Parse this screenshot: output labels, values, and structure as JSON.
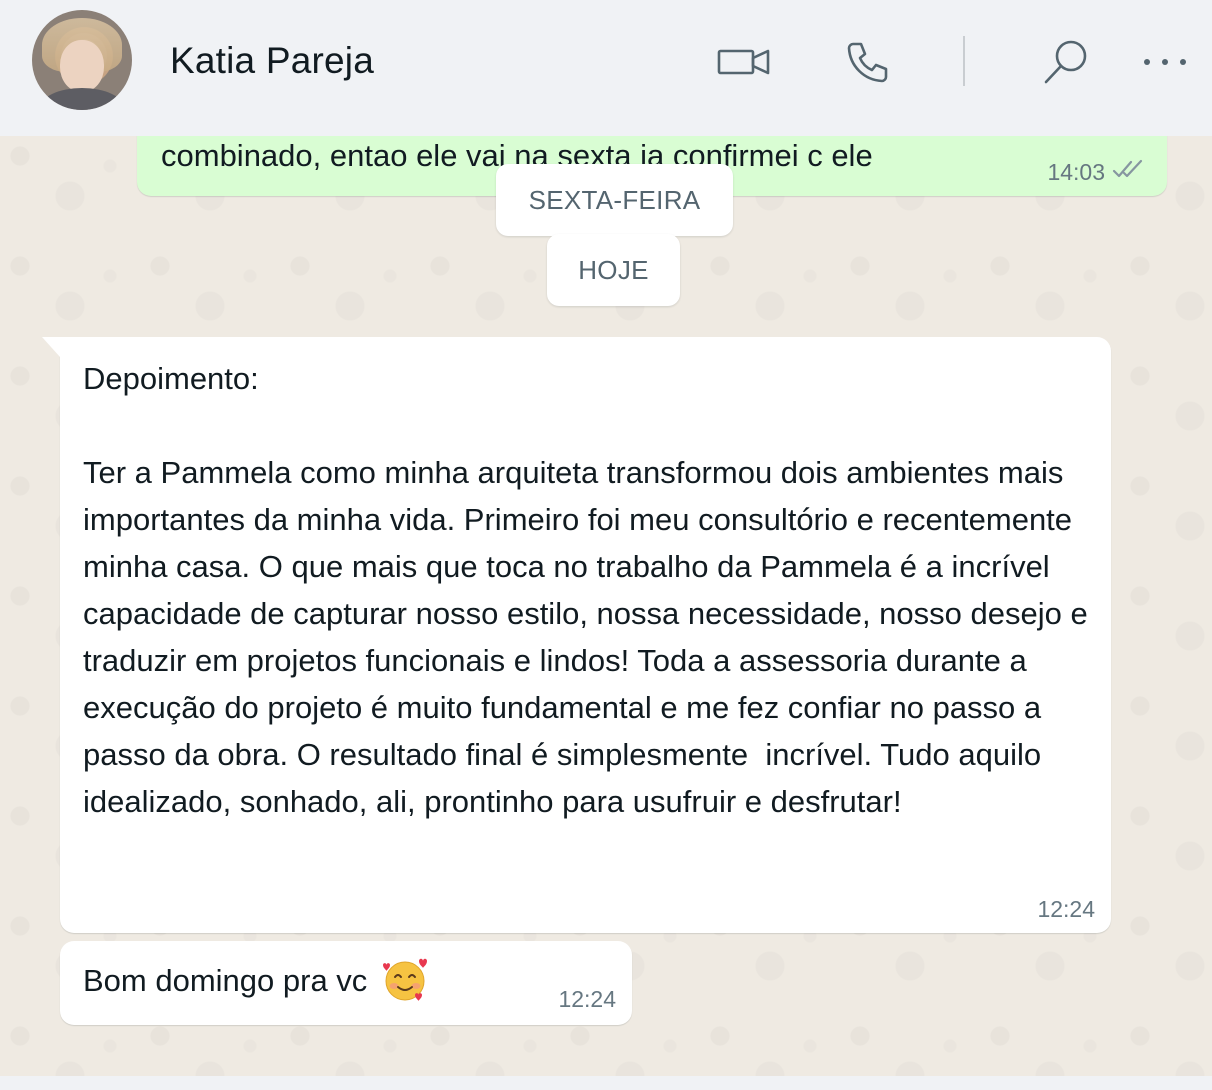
{
  "header": {
    "contact_name": "Katia Pareja",
    "icons": [
      "video-call-icon",
      "voice-call-icon",
      "search-icon",
      "more-options-icon"
    ]
  },
  "messages": {
    "outgoing_partial": {
      "text": "combinado, entao ele vai na sexta ja confirmei c ele",
      "time": "14:03",
      "status": "read-double-check"
    },
    "date_chips": {
      "sexta": "SEXTA-FEIRA",
      "hoje": "HOJE"
    },
    "incoming_testimonial": {
      "text": "Depoimento:\n\nTer a Pammela como minha arquiteta transformou dois ambientes mais importantes da minha vida. Primeiro foi meu consultório e recentemente minha casa. O que mais que toca no trabalho da Pammela é a incrível capacidade de capturar nosso estilo, nossa necessidade, nosso desejo e traduzir em projetos funcionais e lindos! Toda a assessoria durante a execução do projeto é muito fundamental e me fez confiar no passo a passo da obra. O resultado final é simplesmente  incrível. Tudo aquilo idealizado, sonhado, ali, prontinho para usufruir e desfrutar!",
      "time": "12:24"
    },
    "incoming_greeting": {
      "text": "Bom domingo pra vc",
      "emoji": "smiling-face-with-hearts",
      "time": "12:24"
    }
  },
  "colors": {
    "header_bg": "#f0f2f5",
    "chat_bg": "#efeae2",
    "outgoing_bubble": "#d9fdd3",
    "incoming_bubble": "#ffffff",
    "meta_text": "#667781",
    "read_tick": "#8696a0"
  }
}
